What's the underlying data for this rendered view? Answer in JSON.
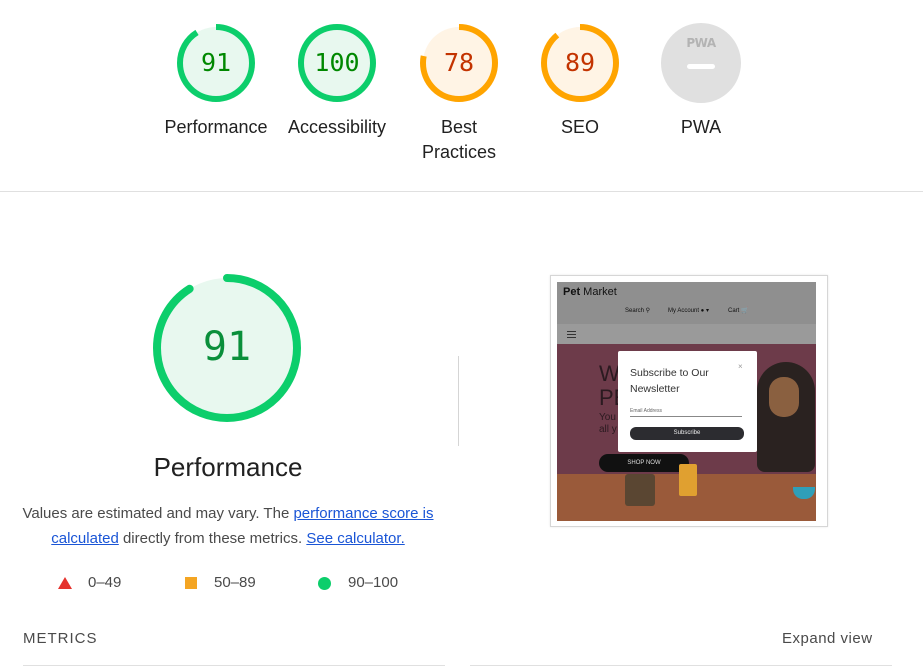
{
  "colors": {
    "pass": "#0cce6b",
    "pass_text": "#008800",
    "pass_bg": "#e8f8ef",
    "average": "#ffa400",
    "average_text": "#c33300",
    "average_bg": "#fff4e5",
    "fail": "#e5322d",
    "na": "#e0e0e0"
  },
  "summary": {
    "categories": [
      {
        "score": "91",
        "value": 91,
        "label": "Performance",
        "status": "pass"
      },
      {
        "score": "100",
        "value": 100,
        "label": "Accessibility",
        "status": "pass"
      },
      {
        "score": "78",
        "value": 78,
        "label": "Best Practices",
        "label_line1": "Best",
        "label_line2": "Practices",
        "status": "average"
      },
      {
        "score": "89",
        "value": 89,
        "label": "SEO",
        "status": "average"
      },
      {
        "score": "PWA",
        "label": "PWA",
        "status": "na"
      }
    ]
  },
  "performance": {
    "score": "91",
    "value": 91,
    "title": "Performance",
    "desc_prefix": "Values are estimated and may vary. The ",
    "desc_link1": "performance score is calculated",
    "desc_middle": " directly from these metrics. ",
    "desc_link2": "See calculator."
  },
  "legend": [
    {
      "icon": "triangle-icon",
      "range": "0–49"
    },
    {
      "icon": "square-icon",
      "range": "50–89"
    },
    {
      "icon": "circle-icon",
      "range": "90–100"
    }
  ],
  "screenshot": {
    "brand_bold": "Pet",
    "brand_rest": " Market",
    "nav_search": "Search",
    "nav_account": "My Account",
    "nav_cart": "Cart",
    "hero_big": "W\nPE",
    "hero_small": "You\nall y",
    "shop_button": "SHOP NOW",
    "popup_title": "Subscribe to Our Newsletter",
    "popup_close": "×",
    "popup_email_placeholder": "Email Address",
    "popup_button": "Subscribe"
  },
  "metrics": {
    "label": "METRICS",
    "expand": "Expand view"
  }
}
